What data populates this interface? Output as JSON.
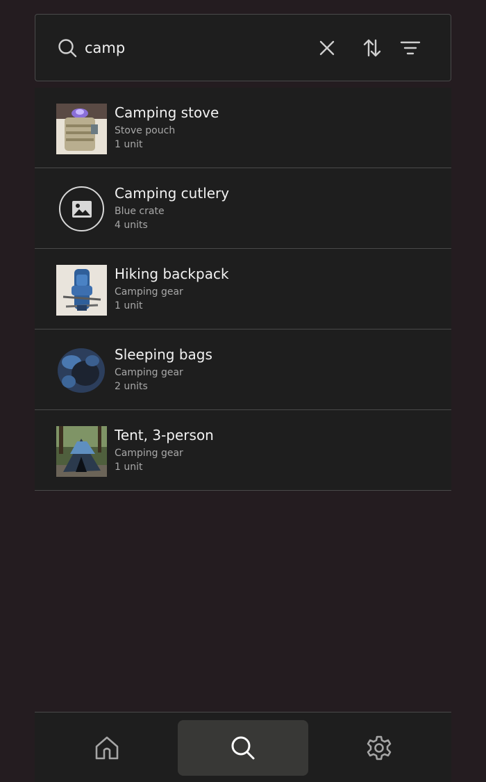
{
  "search": {
    "query": "camp",
    "icons": {
      "lead": "search-icon",
      "clear": "close-icon",
      "sort": "sort-icon",
      "filter": "filter-icon"
    }
  },
  "results": [
    {
      "title": "Camping stove",
      "location": "Stove pouch",
      "quantity": "1 unit",
      "thumbnail": "camping-stove-photo"
    },
    {
      "title": "Camping cutlery",
      "location": "Blue crate",
      "quantity": "4 units",
      "thumbnail": "image-placeholder-icon"
    },
    {
      "title": "Hiking backpack",
      "location": "Camping gear",
      "quantity": "1 unit",
      "thumbnail": "hiking-backpack-photo"
    },
    {
      "title": "Sleeping bags",
      "location": "Camping gear",
      "quantity": "2 units",
      "thumbnail": "sleeping-bags-photo"
    },
    {
      "title": "Tent, 3-person",
      "location": "Camping gear",
      "quantity": "1 unit",
      "thumbnail": "tent-photo"
    }
  ],
  "nav": {
    "items": [
      {
        "icon": "home-icon",
        "active": false
      },
      {
        "icon": "search-icon",
        "active": true
      },
      {
        "icon": "gear-icon",
        "active": false
      }
    ]
  },
  "colors": {
    "background": "#241c20",
    "surface": "#1e1e1e",
    "divider": "#4a4a4a",
    "nav_active": "#383836",
    "text_primary": "#f2f2f2",
    "text_secondary": "#a8a8a8"
  }
}
